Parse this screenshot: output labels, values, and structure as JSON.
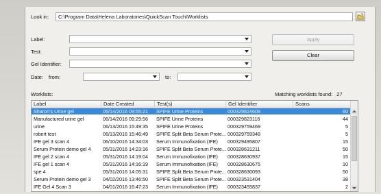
{
  "look_in": {
    "label": "Look in:",
    "path": "C:\\Program Data\\Helena Laboratories\\QuickScan Touch\\Worklists"
  },
  "filters": {
    "label_label": "Label:",
    "test_label": "Test:",
    "gel_identifier_label": "Gel Identifier:",
    "date_label": "Date:",
    "from_label": "from:",
    "to_label": "to:"
  },
  "buttons": {
    "apply": "Apply",
    "clear": "Clear"
  },
  "worklists": {
    "label": "Worklists:",
    "matching_label": "Matching worklists found:",
    "matching_count": "27",
    "columns": [
      "Label",
      "Date Created",
      "Test(s)",
      "Gel Identifier",
      "Scans"
    ],
    "rows": [
      [
        "Sharon's Urine gel",
        "06/14/2016  09:55:21",
        "SPIFE Urine Proteins",
        "000329824608",
        "60"
      ],
      [
        "Manufactured urine gel",
        "06/14/2016  09:29:56",
        "SPIFE Urine Proteins",
        "000329823116",
        "44"
      ],
      [
        "urine",
        "06/13/2016  15:49:35",
        "SPIFE Urine Proteins",
        "000329759469",
        "5"
      ],
      [
        "robert test",
        "06/13/2016  15:46:49",
        "SPIFE Split Beta Serum Prote...",
        "000329759348",
        "5"
      ],
      [
        "IFE gel 3 scan 4",
        "06/10/2016  14:34:03",
        "Serum Immunofixation (IFE)",
        "000329495807",
        "15"
      ],
      [
        "Serum Protein demo gel 4",
        "05/31/2016  14:23:16",
        "SPIFE Split Beta Serum Prote...",
        "000328631211",
        "50"
      ],
      [
        "IFE gel 2 scan 4",
        "05/31/2016  14:19:04",
        "Serum Immunofixation (IFE)",
        "000328630937",
        "15"
      ],
      [
        "IFE gel 1 scan 4",
        "05/31/2016  14:16:19",
        "Serum Immunofixation (IFE)",
        "000328630675",
        "10"
      ],
      [
        "spe 4",
        "05/31/2016  14:05:31",
        "SPIFE Split Beta Serum Prote...",
        "000328630093",
        "50"
      ],
      [
        "Serum Protein demo gel 3",
        "04/02/2016  13:46:50",
        "SPIFE Split Beta Serum Prote...",
        "000323531404",
        "38"
      ],
      [
        "IFE Gel 4 Scan 3",
        "04/01/2016  16:47:23",
        "Serum Immunofixation (IFE)",
        "000323455837",
        "2"
      ]
    ]
  }
}
